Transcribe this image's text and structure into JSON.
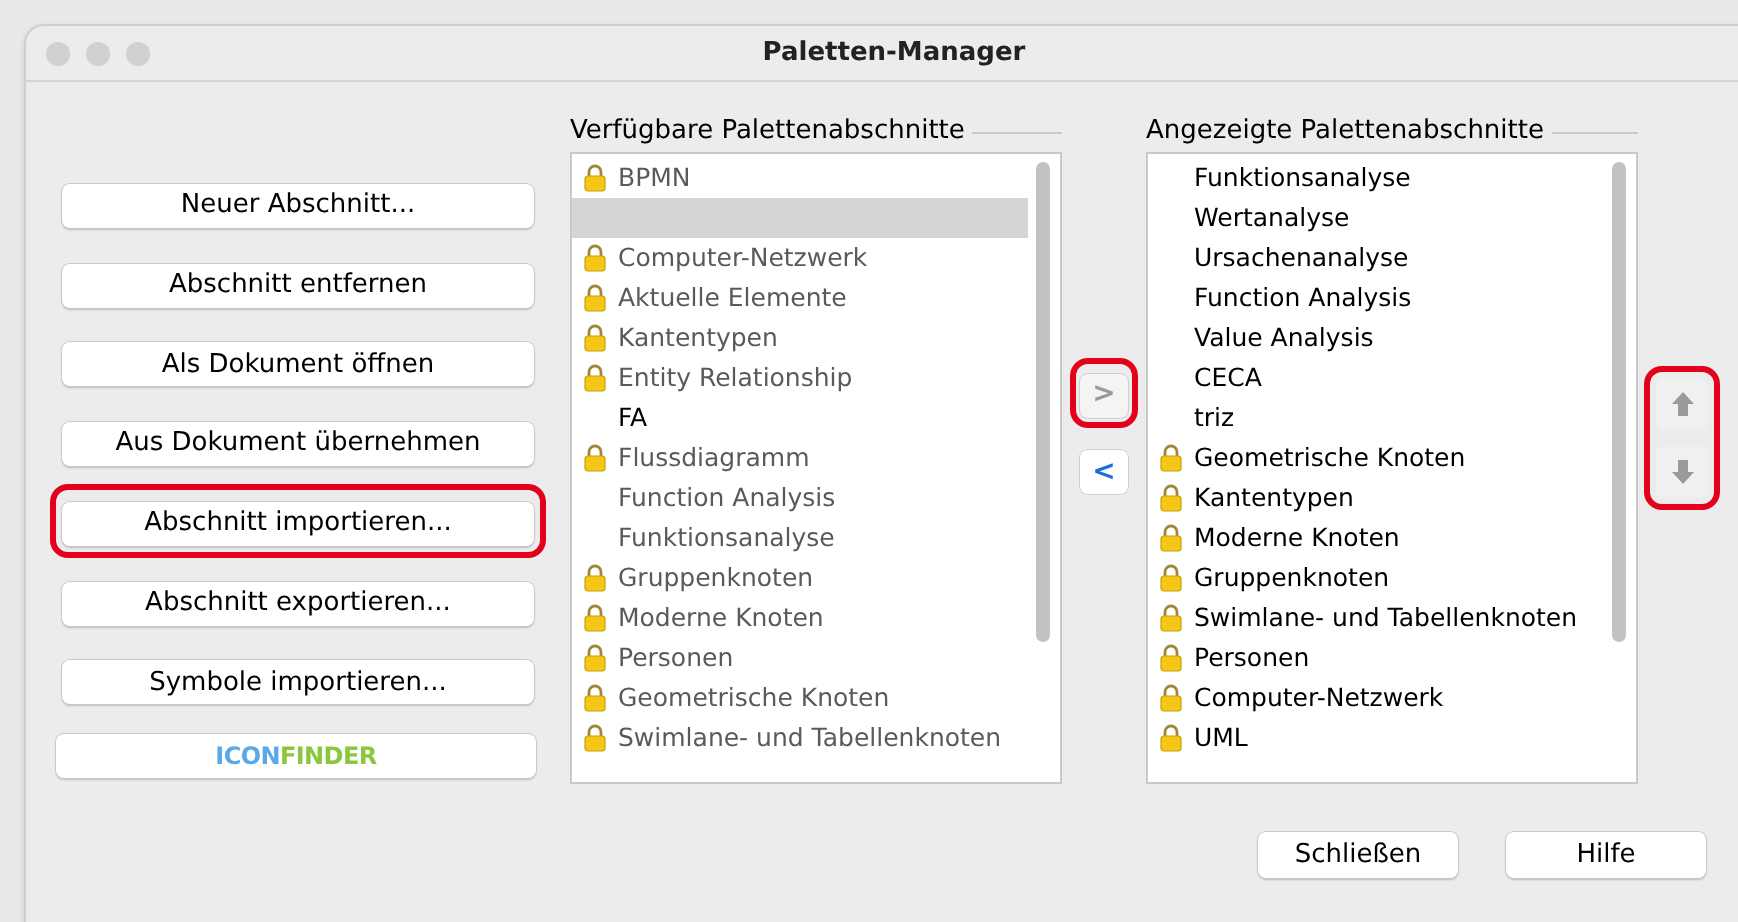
{
  "window": {
    "title": "Paletten-Manager"
  },
  "actions": [
    {
      "label": "Neuer Abschnitt...",
      "highlighted": false
    },
    {
      "label": "Abschnitt entfernen",
      "highlighted": false
    },
    {
      "label": "Als Dokument öffnen",
      "highlighted": false
    },
    {
      "label": "Aus Dokument übernehmen",
      "highlighted": false
    },
    {
      "label": "Abschnitt importieren...",
      "highlighted": true
    },
    {
      "label": "Abschnitt exportieren...",
      "highlighted": false
    },
    {
      "label": "Symbole importieren...",
      "highlighted": false
    }
  ],
  "iconfinder_button": {
    "parts": [
      {
        "text": "ICON",
        "color": "#5aa9e6"
      },
      {
        "text": "FINDER",
        "color": "#8cc63f"
      }
    ]
  },
  "available": {
    "title": "Verfügbare Palettenabschnitte",
    "items": [
      {
        "label": "BPMN",
        "locked": true,
        "dimmed": true,
        "selected": false
      },
      {
        "locked": false,
        "selected": true
      },
      {
        "label": "Computer-Netzwerk",
        "locked": true,
        "dimmed": true,
        "selected": false
      },
      {
        "label": "Aktuelle Elemente",
        "locked": true,
        "dimmed": true,
        "selected": false
      },
      {
        "label": "Kantentypen",
        "locked": true,
        "dimmed": true,
        "selected": false
      },
      {
        "label": "Entity Relationship",
        "locked": true,
        "dimmed": true,
        "selected": false
      },
      {
        "label": "FA",
        "locked": false,
        "dimmed": false,
        "selected": false
      },
      {
        "label": "Flussdiagramm",
        "locked": true,
        "dimmed": true,
        "selected": false
      },
      {
        "label": "Function Analysis",
        "locked": false,
        "dimmed": true,
        "selected": false
      },
      {
        "label": "Funktionsanalyse",
        "locked": false,
        "dimmed": true,
        "selected": false
      },
      {
        "label": "Gruppenknoten",
        "locked": true,
        "dimmed": true,
        "selected": false
      },
      {
        "label": "Moderne Knoten",
        "locked": true,
        "dimmed": true,
        "selected": false
      },
      {
        "label": "Personen",
        "locked": true,
        "dimmed": true,
        "selected": false
      },
      {
        "label": "Geometrische Knoten",
        "locked": true,
        "dimmed": true,
        "selected": false
      },
      {
        "label": "Swimlane- und Tabellenknoten",
        "locked": true,
        "dimmed": true,
        "selected": false
      }
    ]
  },
  "transfer": {
    "add": {
      "label": ">",
      "disabled": true,
      "highlighted": true
    },
    "remove": {
      "label": "<",
      "disabled": false,
      "highlighted": false
    }
  },
  "displayed": {
    "title": "Angezeigte Palettenabschnitte",
    "items": [
      {
        "label": "Funktionsanalyse",
        "locked": false,
        "dimmed": false,
        "selected": false
      },
      {
        "label": "Wertanalyse",
        "locked": false,
        "dimmed": false,
        "selected": false
      },
      {
        "label": "Ursachenanalyse",
        "locked": false,
        "dimmed": false,
        "selected": false
      },
      {
        "label": "Function Analysis",
        "locked": false,
        "dimmed": false,
        "selected": false
      },
      {
        "label": "Value Analysis",
        "locked": false,
        "dimmed": false,
        "selected": false
      },
      {
        "label": "CECA",
        "locked": false,
        "dimmed": false,
        "selected": false
      },
      {
        "label": "triz",
        "locked": false,
        "dimmed": false,
        "selected": false
      },
      {
        "label": "Geometrische Knoten",
        "locked": true,
        "dimmed": false,
        "selected": false
      },
      {
        "label": "Kantentypen",
        "locked": true,
        "dimmed": false,
        "selected": false
      },
      {
        "label": "Moderne Knoten",
        "locked": true,
        "dimmed": false,
        "selected": false
      },
      {
        "label": "Gruppenknoten",
        "locked": true,
        "dimmed": false,
        "selected": false
      },
      {
        "label": "Swimlane- und Tabellenknoten",
        "locked": true,
        "dimmed": false,
        "selected": false
      },
      {
        "label": "Personen",
        "locked": true,
        "dimmed": false,
        "selected": false
      },
      {
        "label": "Computer-Netzwerk",
        "locked": true,
        "dimmed": false,
        "selected": false
      },
      {
        "label": "UML",
        "locked": true,
        "dimmed": false,
        "selected": false
      }
    ]
  },
  "reorder": {
    "disabled": true,
    "highlighted": true
  },
  "footer": [
    "Schließen",
    "Hilfe"
  ]
}
